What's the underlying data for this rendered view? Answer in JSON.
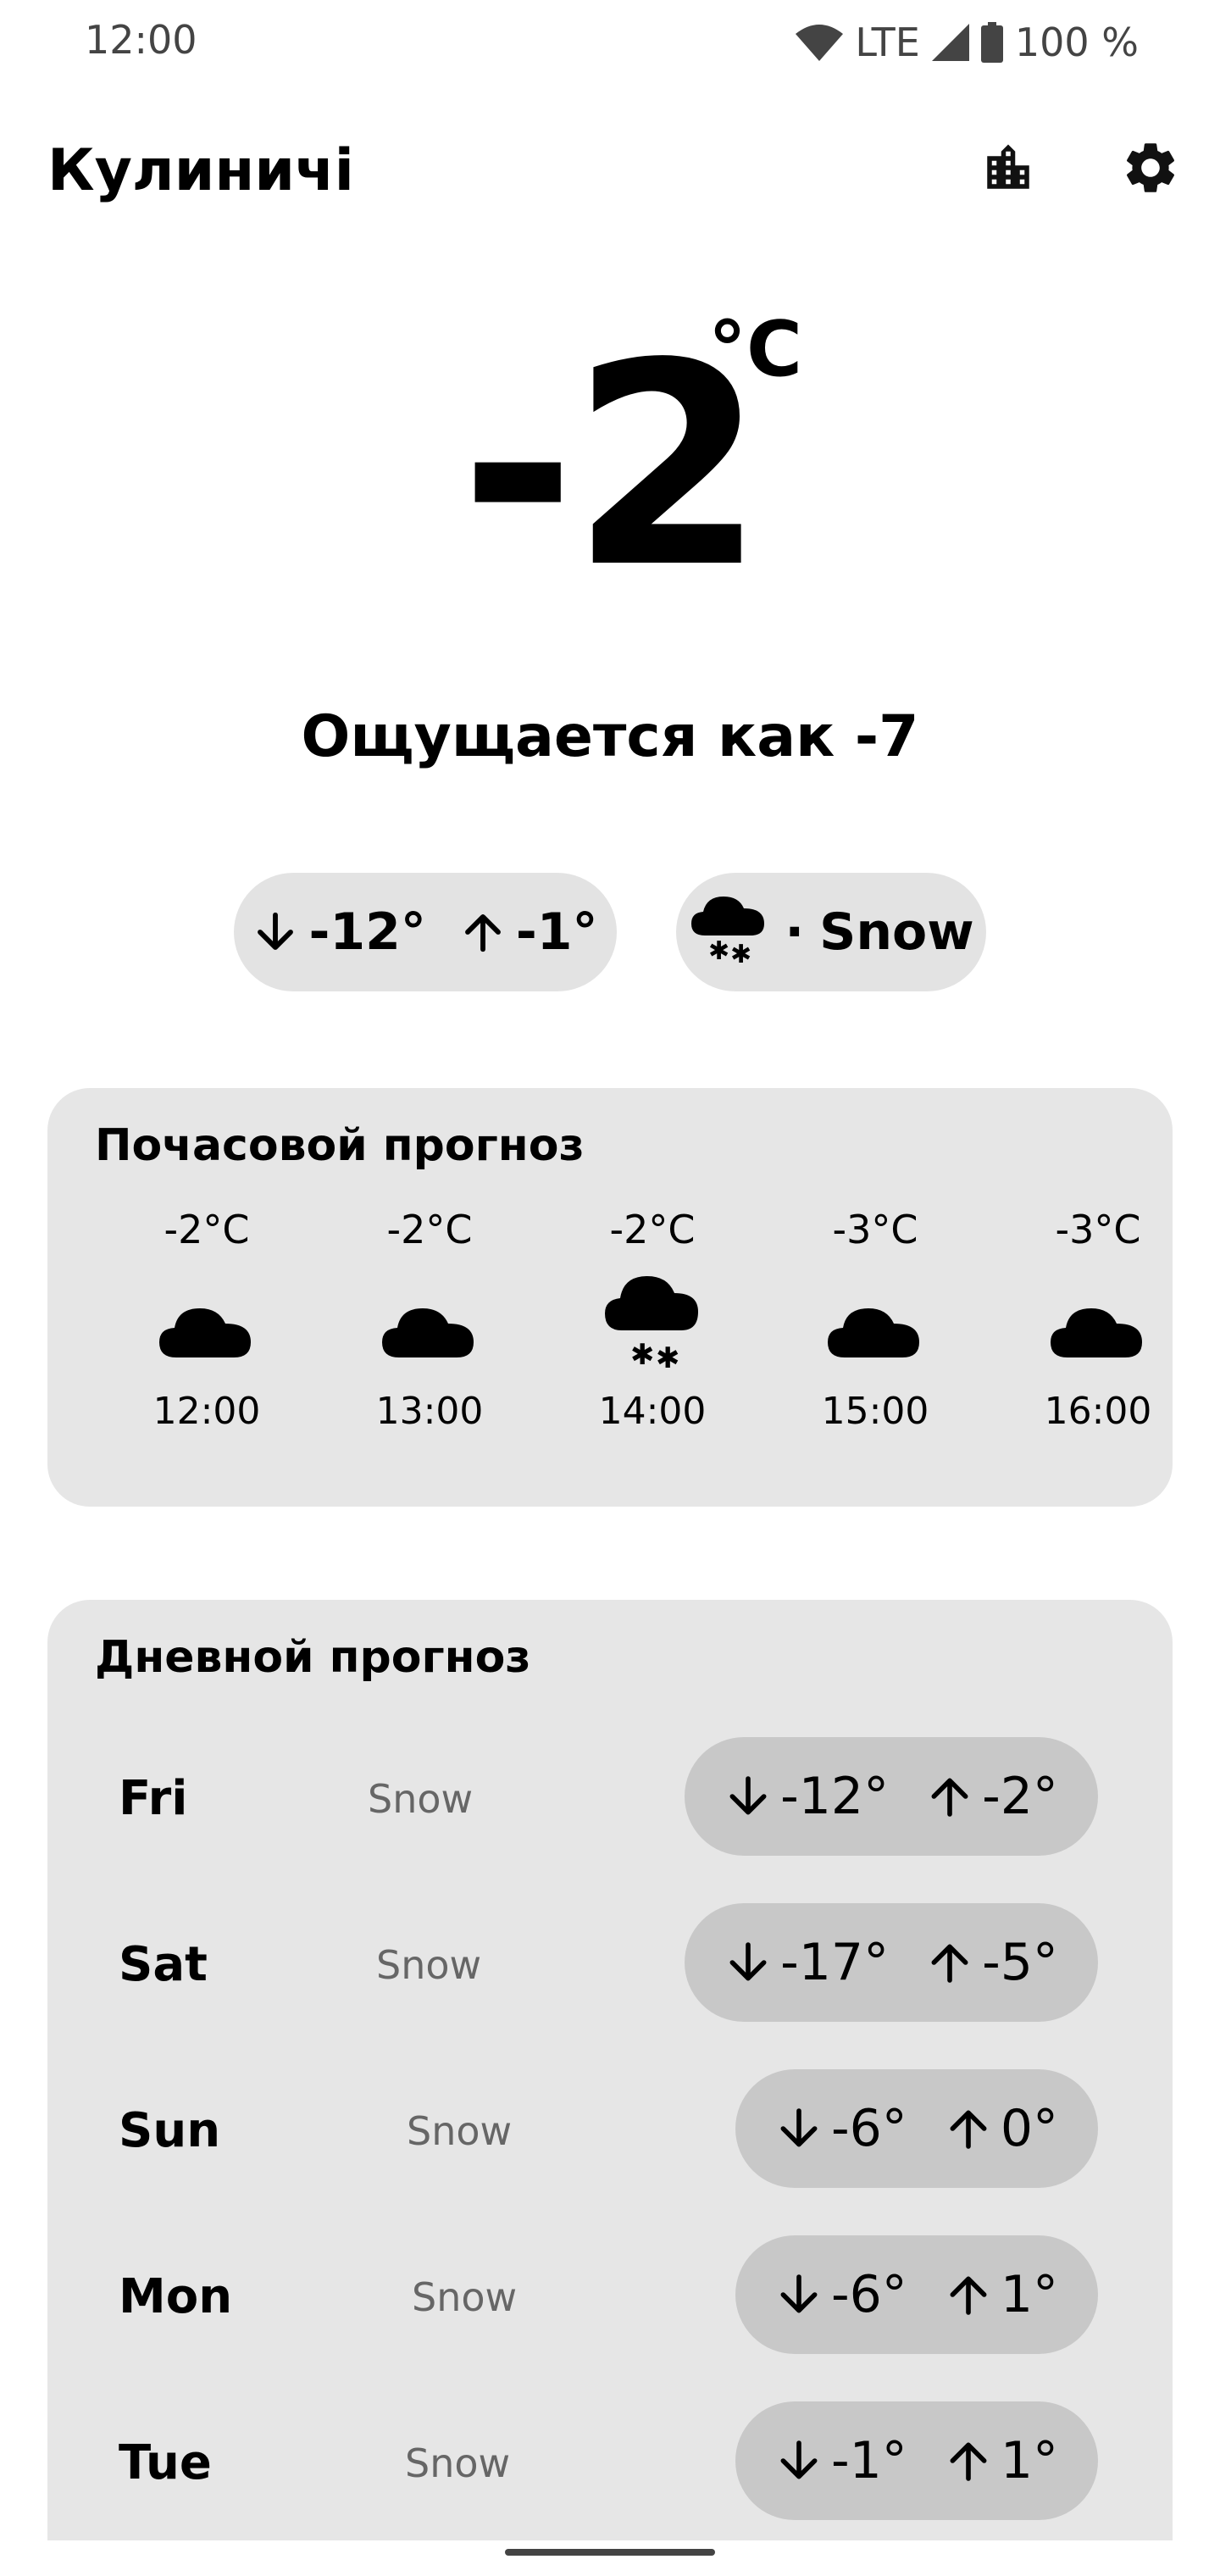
{
  "status_bar": {
    "time": "12:00",
    "network": "LTE",
    "battery": "100 %"
  },
  "header": {
    "location": "Кулиничі",
    "city_icon": "city-icon",
    "settings_icon": "gear-icon"
  },
  "current": {
    "temperature": "-2",
    "unit": "°C",
    "feels_like": "Ощущается как -7",
    "low": "-12°",
    "high": "-1°",
    "condition": "Snow",
    "condition_icon": "cloud-snow-icon",
    "separator": "·"
  },
  "hourly": {
    "title": "Почасовой прогноз",
    "items": [
      {
        "temp": "-2°C",
        "time": "12:00",
        "icon": "cloud-icon"
      },
      {
        "temp": "-2°C",
        "time": "13:00",
        "icon": "cloud-icon"
      },
      {
        "temp": "-2°C",
        "time": "14:00",
        "icon": "cloud-snow-icon"
      },
      {
        "temp": "-3°C",
        "time": "15:00",
        "icon": "cloud-icon"
      },
      {
        "temp": "-3°C",
        "time": "16:00",
        "icon": "cloud-icon"
      }
    ]
  },
  "daily": {
    "title": "Дневной прогноз",
    "items": [
      {
        "day": "Fri",
        "condition": "Snow",
        "low": "-12°",
        "high": "-2°"
      },
      {
        "day": "Sat",
        "condition": "Snow",
        "low": "-17°",
        "high": "-5°"
      },
      {
        "day": "Sun",
        "condition": "Snow",
        "low": "-6°",
        "high": "0°"
      },
      {
        "day": "Mon",
        "condition": "Snow",
        "low": "-6°",
        "high": "1°"
      },
      {
        "day": "Tue",
        "condition": "Snow",
        "low": "-1°",
        "high": "1°"
      }
    ]
  },
  "colors": {
    "background": "#ffffff",
    "card": "#e6e6e6",
    "chip": "#e3e3e3",
    "day_chip": "#c8c8c8",
    "secondary_text": "#666666"
  }
}
